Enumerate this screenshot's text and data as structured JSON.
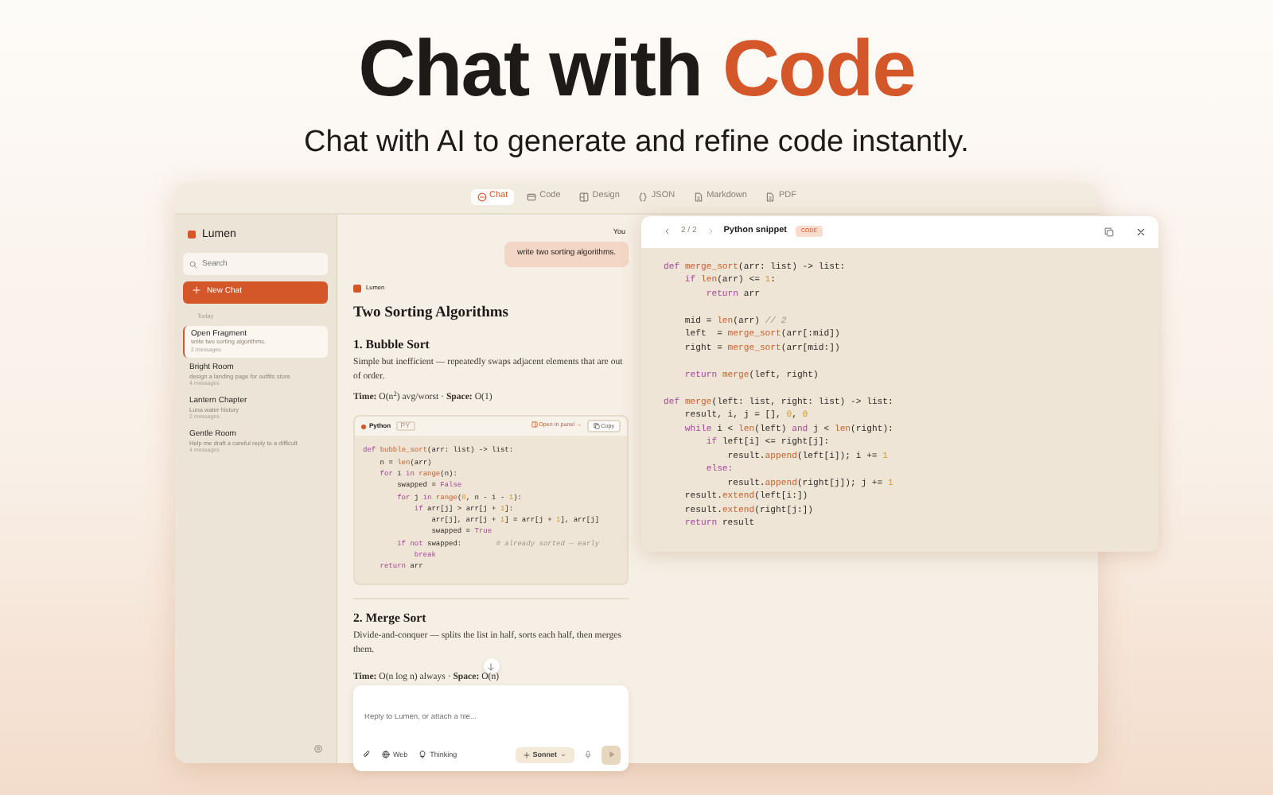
{
  "hero": {
    "title_start": "Chat with ",
    "title_accent": "Code",
    "subtitle": "Chat with AI to generate and refine code instantly."
  },
  "tabs": [
    {
      "label": "Chat",
      "selected": true
    },
    {
      "label": "Code",
      "selected": false
    },
    {
      "label": "Design",
      "selected": false
    },
    {
      "label": "JSON",
      "selected": false
    },
    {
      "label": "Markdown",
      "selected": false
    },
    {
      "label": "PDF",
      "selected": false
    }
  ],
  "sidebar": {
    "brand": "Lumen",
    "search_placeholder": "Search",
    "new_chat": "New Chat",
    "group": "Today",
    "items": [
      {
        "title": "Open Fragment",
        "preview": "write two sorting algorithms.",
        "count": "2 messages",
        "selected": true
      },
      {
        "title": "Bright Room",
        "preview": "design a landing page for outfits store",
        "count": "4 messages",
        "selected": false
      },
      {
        "title": "Lantern Chapter",
        "preview": "Luna water history",
        "count": "2 messages",
        "selected": false
      },
      {
        "title": "Gentle Room",
        "preview": "Help me draft a careful reply to a difficult",
        "count": "4 messages",
        "selected": false
      }
    ]
  },
  "chat": {
    "user_label": "You",
    "user_message": "write two sorting algorithms.",
    "assistant_label": "Lumen",
    "title": "Two Sorting Algorithms",
    "sections": [
      {
        "heading": "1. Bubble Sort",
        "text": "Simple but inefficient — repeatedly swaps adjacent elements that are out of order.",
        "complexity": "**Time:** O(n$^{2}$) avg/worst · **Space:** O(1)"
      },
      {
        "heading": "2. Merge Sort",
        "text": "Divide-and-conquer — splits the list in half, sorts each half, then merges them.",
        "complexity": "**Time:** O(n log n) always · **Space:** O(n)"
      }
    ],
    "code_block": {
      "language": "Python",
      "badge": "PY",
      "open_label": "Open in panel →",
      "copy_label": "Copy",
      "lines": [
        [
          {
            "text": "def ",
            "kind": "kw"
          },
          {
            "text": "bubble_sort",
            "kind": "fn"
          },
          {
            "text": "(arr: list) -> list:",
            "kind": "p"
          }
        ],
        [
          {
            "text": "    n = ",
            "kind": "p"
          },
          {
            "text": "len",
            "kind": "fn"
          },
          {
            "text": "(arr)",
            "kind": "p"
          }
        ],
        [
          {
            "text": "    for ",
            "kind": "kw"
          },
          {
            "text": "i ",
            "kind": "p"
          },
          {
            "text": "in ",
            "kind": "kw"
          },
          {
            "text": "range",
            "kind": "fn"
          },
          {
            "text": "(n):",
            "kind": "p"
          }
        ],
        [
          {
            "text": "        swapped = ",
            "kind": "p"
          },
          {
            "text": "False",
            "kind": "kw"
          }
        ],
        [
          {
            "text": "        for ",
            "kind": "kw"
          },
          {
            "text": "j ",
            "kind": "p"
          },
          {
            "text": "in ",
            "kind": "kw"
          },
          {
            "text": "range",
            "kind": "fn"
          },
          {
            "text": "(",
            "kind": "p"
          },
          {
            "text": "0",
            "kind": "num"
          },
          {
            "text": ", n - i - ",
            "kind": "p"
          },
          {
            "text": "1",
            "kind": "num"
          },
          {
            "text": "):",
            "kind": "p"
          }
        ],
        [
          {
            "text": "            if ",
            "kind": "kw"
          },
          {
            "text": "arr[j] > arr[j + ",
            "kind": "p"
          },
          {
            "text": "1",
            "kind": "num"
          },
          {
            "text": "]:",
            "kind": "p"
          }
        ],
        [
          {
            "text": "                arr[j], arr[j + ",
            "kind": "p"
          },
          {
            "text": "1",
            "kind": "num"
          },
          {
            "text": "] = arr[j + ",
            "kind": "p"
          },
          {
            "text": "1",
            "kind": "num"
          },
          {
            "text": "], arr[j]",
            "kind": "p"
          }
        ],
        [
          {
            "text": "                swapped = ",
            "kind": "p"
          },
          {
            "text": "True",
            "kind": "kw"
          }
        ],
        [
          {
            "text": "        if not ",
            "kind": "kw"
          },
          {
            "text": "swapped:        ",
            "kind": "p"
          },
          {
            "text": "# already sorted — early",
            "kind": "cmt"
          }
        ],
        [
          {
            "text": "            break",
            "kind": "kw"
          }
        ],
        [
          {
            "text": "    return ",
            "kind": "kw"
          },
          {
            "text": "arr",
            "kind": "p"
          }
        ]
      ]
    },
    "input": {
      "placeholder": "Reply to Lumen, or attach a file...",
      "web": "Web",
      "thinking": "Thinking",
      "model": "Sonnet"
    }
  },
  "panel": {
    "pager": "2 / 2",
    "title": "Python snippet",
    "badge": "CODE",
    "blocks": [
      [
        [
          {
            "text": "def ",
            "kind": "kw"
          },
          {
            "text": "merge_sort",
            "kind": "fn"
          },
          {
            "text": "(arr: list) -> list:",
            "kind": "p"
          }
        ],
        [
          {
            "text": "    if ",
            "kind": "kw"
          },
          {
            "text": "len",
            "kind": "fn"
          },
          {
            "text": "(arr) <= ",
            "kind": "p"
          },
          {
            "text": "1",
            "kind": "num"
          },
          {
            "text": ":",
            "kind": "p"
          }
        ],
        [
          {
            "text": "        return ",
            "kind": "kw"
          },
          {
            "text": "arr",
            "kind": "p"
          }
        ]
      ],
      [
        [
          {
            "text": "    mid = ",
            "kind": "p"
          },
          {
            "text": "len",
            "kind": "fn"
          },
          {
            "text": "(arr) ",
            "kind": "p"
          },
          {
            "text": "// 2",
            "kind": "cmt"
          }
        ],
        [
          {
            "text": "    left  = ",
            "kind": "p"
          },
          {
            "text": "merge_sort",
            "kind": "fn"
          },
          {
            "text": "(arr[:mid])",
            "kind": "p"
          }
        ],
        [
          {
            "text": "    right = ",
            "kind": "p"
          },
          {
            "text": "merge_sort",
            "kind": "fn"
          },
          {
            "text": "(arr[mid:])",
            "kind": "p"
          }
        ]
      ],
      [
        [
          {
            "text": "    return ",
            "kind": "kw"
          },
          {
            "text": "merge",
            "kind": "fn"
          },
          {
            "text": "(left, right)",
            "kind": "p"
          }
        ]
      ],
      [
        [
          {
            "text": "def ",
            "kind": "kw"
          },
          {
            "text": "merge",
            "kind": "fn"
          },
          {
            "text": "(left: list, right: list) -> list:",
            "kind": "p"
          }
        ],
        [
          {
            "text": "    result, i, j = [], ",
            "kind": "p"
          },
          {
            "text": "0",
            "kind": "num"
          },
          {
            "text": ", ",
            "kind": "p"
          },
          {
            "text": "0",
            "kind": "num"
          }
        ],
        [
          {
            "text": "    while ",
            "kind": "kw"
          },
          {
            "text": "i < ",
            "kind": "p"
          },
          {
            "text": "len",
            "kind": "fn"
          },
          {
            "text": "(left) ",
            "kind": "p"
          },
          {
            "text": "and ",
            "kind": "kw"
          },
          {
            "text": "j < ",
            "kind": "p"
          },
          {
            "text": "len",
            "kind": "fn"
          },
          {
            "text": "(right):",
            "kind": "p"
          }
        ],
        [
          {
            "text": "        if ",
            "kind": "kw"
          },
          {
            "text": "left[i] <= right[j]:",
            "kind": "p"
          }
        ],
        [
          {
            "text": "            result.",
            "kind": "p"
          },
          {
            "text": "append",
            "kind": "fn"
          },
          {
            "text": "(left[i]); i += ",
            "kind": "p"
          },
          {
            "text": "1",
            "kind": "num"
          }
        ],
        [
          {
            "text": "        else:",
            "kind": "kw"
          }
        ],
        [
          {
            "text": "            result.",
            "kind": "p"
          },
          {
            "text": "append",
            "kind": "fn"
          },
          {
            "text": "(right[j]); j += ",
            "kind": "p"
          },
          {
            "text": "1",
            "kind": "num"
          }
        ],
        [
          {
            "text": "    result.",
            "kind": "p"
          },
          {
            "text": "extend",
            "kind": "fn"
          },
          {
            "text": "(left[i:])",
            "kind": "p"
          }
        ],
        [
          {
            "text": "    result.",
            "kind": "p"
          },
          {
            "text": "extend",
            "kind": "fn"
          },
          {
            "text": "(right[j:])",
            "kind": "p"
          }
        ],
        [
          {
            "text": "    return ",
            "kind": "kw"
          },
          {
            "text": "result",
            "kind": "p"
          }
        ]
      ]
    ]
  }
}
